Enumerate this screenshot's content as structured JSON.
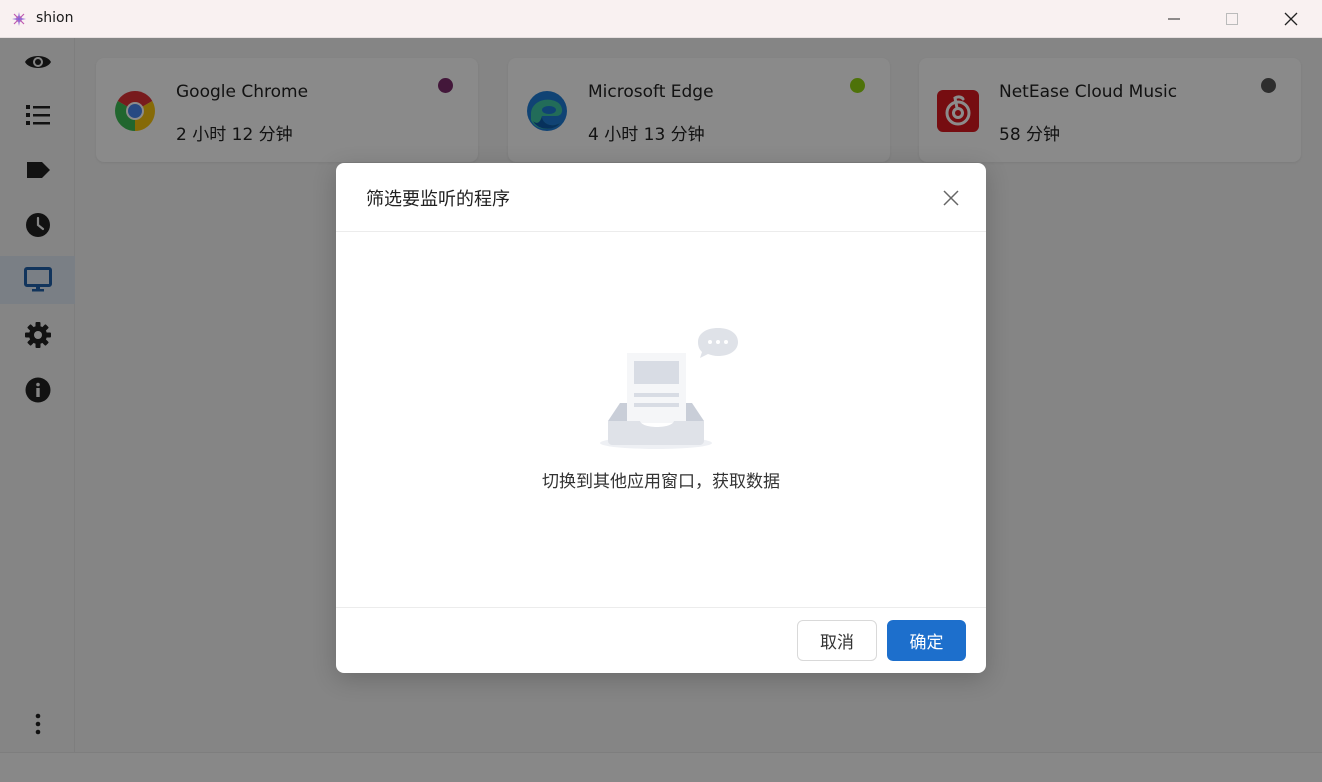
{
  "window": {
    "title": "shion"
  },
  "sidebar": {
    "items": [
      {
        "icon": "eye-icon",
        "active": false
      },
      {
        "icon": "list-icon",
        "active": false
      },
      {
        "icon": "tag-icon",
        "active": false
      },
      {
        "icon": "clock-icon",
        "active": false
      },
      {
        "icon": "monitor-icon",
        "active": true
      },
      {
        "icon": "gear-icon",
        "active": false
      },
      {
        "icon": "info-icon",
        "active": false
      }
    ],
    "more_icon": "more-vertical-icon"
  },
  "cards": [
    {
      "name": "Google Chrome",
      "time": "2 小时 12 分钟",
      "dot_color": "#7a2a6a",
      "icon": "chrome-icon"
    },
    {
      "name": "Microsoft Edge",
      "time": "4 小时 13 分钟",
      "dot_color": "#8fcf12",
      "icon": "edge-icon"
    },
    {
      "name": "NetEase Cloud Music",
      "time": "58 分钟",
      "dot_color": "#555555",
      "icon": "netease-music-icon"
    }
  ],
  "modal": {
    "title": "筛选要监听的程序",
    "empty_text": "切换到其他应用窗口，获取数据",
    "cancel_label": "取消",
    "ok_label": "确定"
  },
  "colors": {
    "accent": "#1d6fcc",
    "active_nav_icon": "#1f5fa8"
  }
}
